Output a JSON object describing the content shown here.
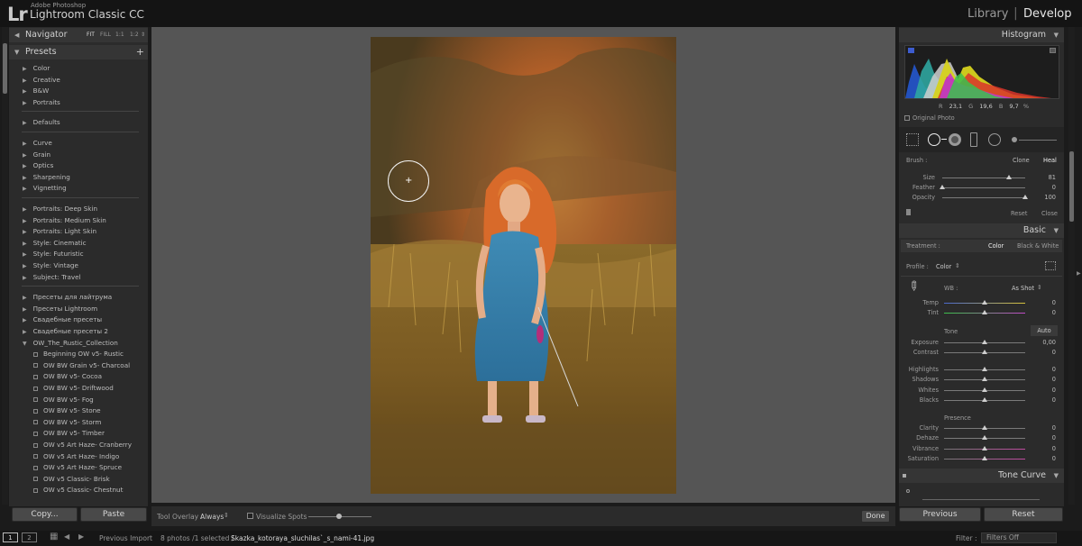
{
  "app": {
    "logo": "Lr",
    "vendor": "Adobe Photoshop",
    "name": "Lightroom Classic CC",
    "modules": [
      "Library",
      "Develop"
    ],
    "active_module": "Develop"
  },
  "navigator": {
    "title": "Navigator",
    "zoom_options": [
      "FIT",
      "FILL",
      "1:1",
      "1:2"
    ]
  },
  "presets": {
    "title": "Presets",
    "add_label": "+",
    "groups": [
      [
        "Color",
        "Creative",
        "B&W",
        "Portraits"
      ],
      [
        "Defaults"
      ],
      [
        "Curve",
        "Grain",
        "Optics",
        "Sharpening",
        "Vignetting"
      ],
      [
        "Portraits: Deep Skin",
        "Portraits: Medium Skin",
        "Portraits: Light Skin",
        "Style: Cinematic",
        "Style: Futuristic",
        "Style: Vintage",
        "Subject: Travel"
      ],
      [
        "Пресеты для лайтрума",
        "Пресеты Lightroom",
        "Свадебные пресеты",
        "Свадебные пресеты 2",
        "OW_The_Rustic_Collection"
      ]
    ],
    "sub_items": [
      "Beginning OW v5- Rustic",
      "OW BW Grain v5- Charcoal",
      "OW BW v5- Cocoa",
      "OW BW v5- Driftwood",
      "OW BW v5- Fog",
      "OW BW v5- Stone",
      "OW BW v5- Storm",
      "OW BW v5- Timber",
      "OW v5 Art Haze- Cranberry",
      "OW v5 Art Haze- Indigo",
      "OW v5 Art Haze- Spruce",
      "OW v5 Classic- Brisk",
      "OW v5 Classic- Chestnut"
    ]
  },
  "left_buttons": {
    "copy": "Copy...",
    "paste": "Paste"
  },
  "toolbar": {
    "tool_overlay_label": "Tool Overlay :",
    "tool_overlay_value": "Always",
    "visualize_spots": "Visualize Spots",
    "visualize_spots_checked": false,
    "done": "Done"
  },
  "filmstrip": {
    "view1": "1",
    "view2": "2",
    "previous_import": "Previous Import",
    "selection_info": "8 photos /1 selected /",
    "filename": "Skazka_kotoraya_sluchilas`_s_nami-41.jpg",
    "filter_label": "Filter :",
    "filter_value": "Filters Off"
  },
  "histogram": {
    "title": "Histogram",
    "r_label": "R",
    "r_value": "23,1",
    "g_label": "G",
    "g_value": "19,6",
    "b_label": "B",
    "b_value": "9,7",
    "percent": "%",
    "original_photo": "Original Photo"
  },
  "spot_removal": {
    "brush_label": "Brush :",
    "modes": [
      "Clone",
      "Heal"
    ],
    "active_mode": "Heal",
    "sliders": [
      {
        "label": "Size",
        "value": "81",
        "fraction": 0.8
      },
      {
        "label": "Feather",
        "value": "0",
        "fraction": 0.0
      },
      {
        "label": "Opacity",
        "value": "100",
        "fraction": 1.0
      }
    ],
    "reset": "Reset",
    "close": "Close"
  },
  "basic": {
    "title": "Basic",
    "treatment_label": "Treatment :",
    "treatment_options": [
      "Color",
      "Black & White"
    ],
    "treatment_active": "Color",
    "profile_label": "Profile :",
    "profile_value": "Color",
    "wb_label": "WB :",
    "wb_value": "As Shot",
    "wb_sliders": [
      {
        "label": "Temp",
        "value": "0",
        "fraction": 0.5
      },
      {
        "label": "Tint",
        "value": "0",
        "fraction": 0.5
      }
    ],
    "tone_label": "Tone",
    "auto": "Auto",
    "tone_sliders": [
      {
        "label": "Exposure",
        "value": "0,00",
        "fraction": 0.5
      },
      {
        "label": "Contrast",
        "value": "0",
        "fraction": 0.5
      }
    ],
    "tone_sliders2": [
      {
        "label": "Highlights",
        "value": "0",
        "fraction": 0.5
      },
      {
        "label": "Shadows",
        "value": "0",
        "fraction": 0.5
      },
      {
        "label": "Whites",
        "value": "0",
        "fraction": 0.5
      },
      {
        "label": "Blacks",
        "value": "0",
        "fraction": 0.5
      }
    ],
    "presence_label": "Presence",
    "presence_sliders": [
      {
        "label": "Clarity",
        "value": "0",
        "fraction": 0.5
      },
      {
        "label": "Dehaze",
        "value": "0",
        "fraction": 0.5
      },
      {
        "label": "Vibrance",
        "value": "0",
        "fraction": 0.5
      },
      {
        "label": "Saturation",
        "value": "0",
        "fraction": 0.5
      }
    ]
  },
  "tone_curve": {
    "title": "Tone Curve"
  },
  "right_buttons": {
    "previous": "Previous",
    "reset": "Reset"
  }
}
